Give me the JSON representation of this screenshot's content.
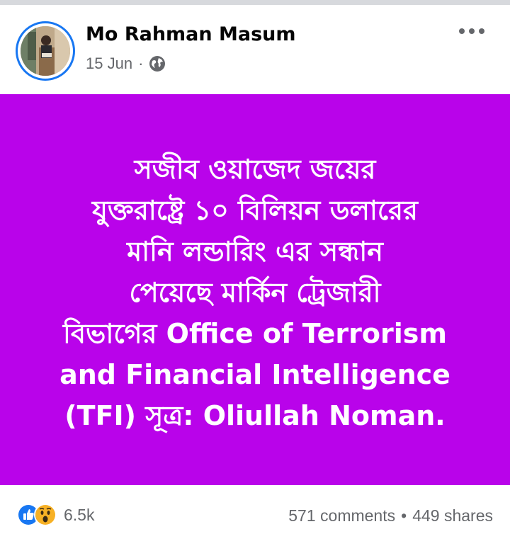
{
  "post": {
    "author": "Mo Rahman Masum",
    "date": "15 Jun",
    "separator": "·",
    "privacy_icon": "globe-icon",
    "more_icon": "more-options-icon",
    "background_color": "#b903ea",
    "text_lines": [
      "সজীব ওয়াজেদ জয়ের",
      "যুক্তরাষ্ট্রে ১০ বিলিয়ন ডলারের",
      "মানি লন্ডারিং এর  সন্ধান",
      "পেয়েছে মার্কিন ট্রেজারী",
      "বিভাগের  Office of Terrorism",
      "and Financial Intelligence",
      "(TFI) সূত্র: Oliullah Noman."
    ]
  },
  "footer": {
    "reaction_icons": [
      "like-icon",
      "wow-icon"
    ],
    "reaction_count": "6.5k",
    "comments": "571 comments",
    "stats_separator": "•",
    "shares": "449 shares"
  },
  "colors": {
    "accent": "#1877f2",
    "muted_text": "#65676b",
    "post_bg": "#b903ea"
  }
}
